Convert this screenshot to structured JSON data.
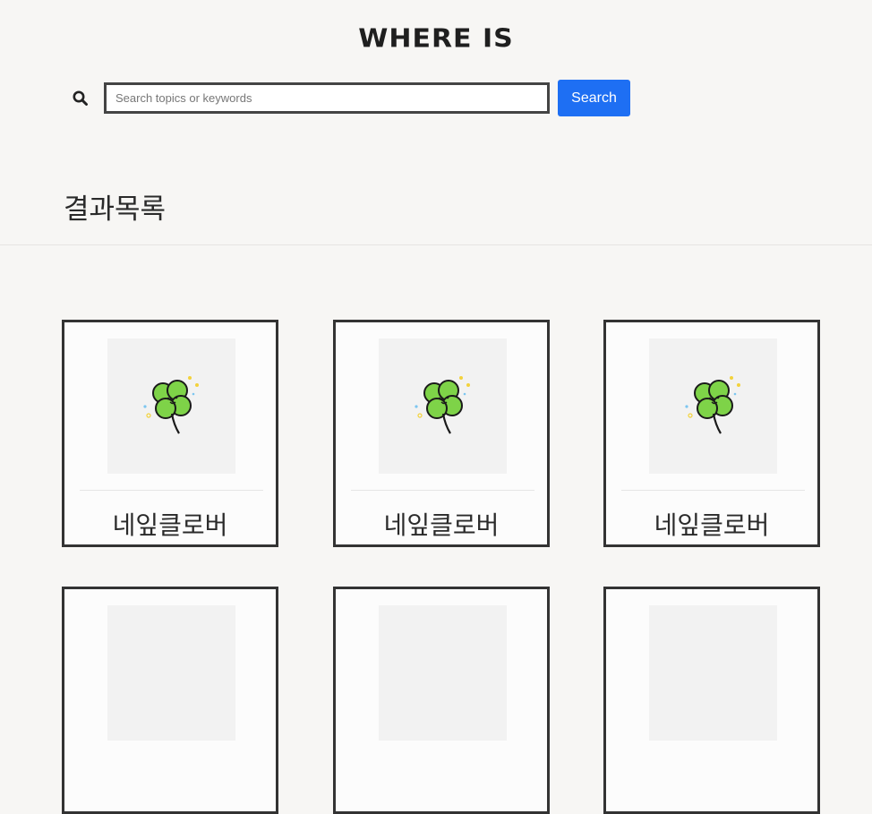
{
  "header": {
    "logo_text": "WHERE IS"
  },
  "search": {
    "placeholder": "Search topics or keywords",
    "value": "",
    "button_label": "Search"
  },
  "results": {
    "title": "결과목록",
    "items": [
      {
        "name": "네잎클로버",
        "image_icon": "four-leaf-clover-icon"
      },
      {
        "name": "네잎클로버",
        "image_icon": "four-leaf-clover-icon"
      },
      {
        "name": "네잎클로버",
        "image_icon": "four-leaf-clover-icon"
      },
      {
        "name": "",
        "image_icon": "four-leaf-clover-icon"
      },
      {
        "name": "",
        "image_icon": "four-leaf-clover-icon"
      },
      {
        "name": "",
        "image_icon": "four-leaf-clover-icon"
      }
    ]
  },
  "colors": {
    "accent": "#1e6ff3",
    "clover": "#7ed348",
    "background": "#f7f6f4"
  }
}
